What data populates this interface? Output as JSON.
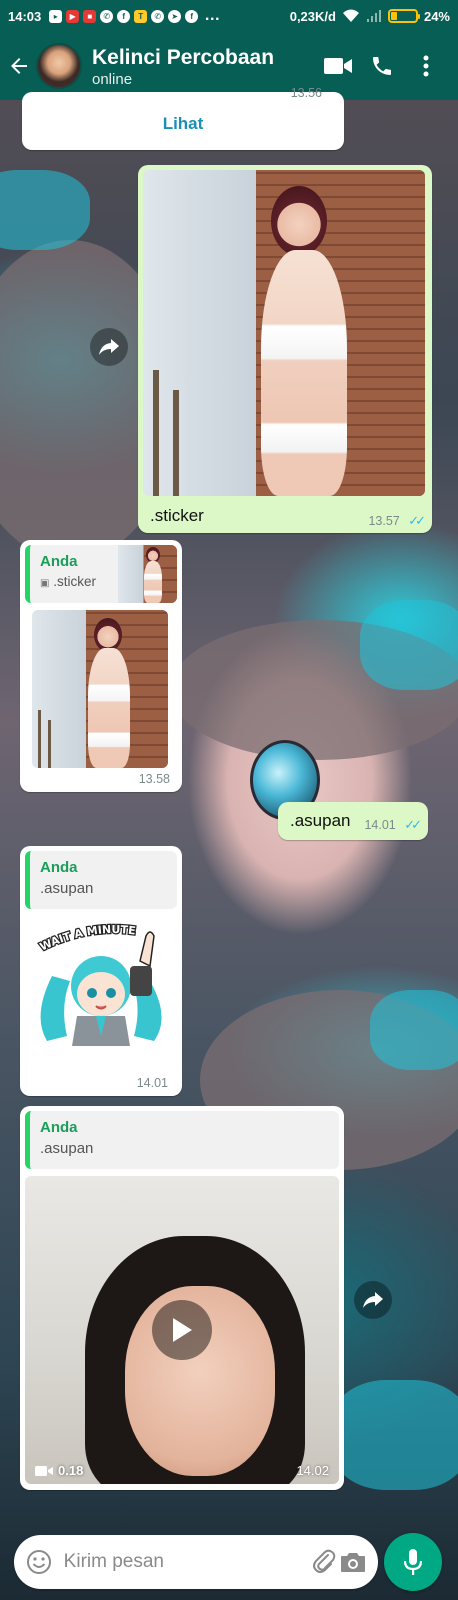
{
  "statusbar": {
    "time": "14:03",
    "network_speed": "0,23K/d",
    "battery": "24%",
    "battery_level": 0.24
  },
  "header": {
    "contact_name": "Kelinci Percobaan",
    "contact_status": "online"
  },
  "messages": {
    "link_preview": {
      "button": "Lihat",
      "time": "13.56"
    },
    "image_out": {
      "caption": ".sticker",
      "time": "13.57"
    },
    "image_reply": {
      "quote_author": "Anda",
      "quote_text": ".sticker",
      "time": "13.58"
    },
    "text_out": {
      "text": ".asupan",
      "time": "14.01"
    },
    "sticker_reply": {
      "quote_author": "Anda",
      "quote_text": ".asupan",
      "sticker_text": "WAIT A MINUTE",
      "time": "14.01"
    },
    "video_reply": {
      "quote_author": "Anda",
      "quote_text": ".asupan",
      "duration": "0.18",
      "time": "14.02"
    }
  },
  "input": {
    "placeholder": "Kirim pesan"
  },
  "colors": {
    "header": "#075e54",
    "outgoing_bubble": "#dcf8c6",
    "accent": "#00a884",
    "read_ticks": "#34b7f1"
  }
}
